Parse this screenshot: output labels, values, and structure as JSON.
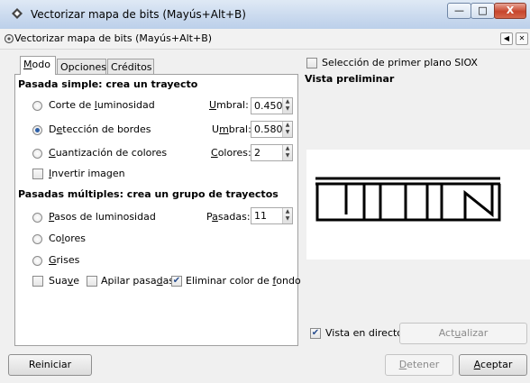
{
  "window": {
    "title": "Vectorizar mapa de bits (Mayús+Alt+B)",
    "minimize_glyph": "—",
    "maximize_glyph": "□",
    "close_glyph": "X"
  },
  "dock": {
    "title": "Vectorizar mapa de bits (Mayús+Alt+B)"
  },
  "tabs": [
    {
      "label": "Modo",
      "accel": "M",
      "rest": "odo",
      "active": true
    },
    {
      "label": "Opciones",
      "active": false
    },
    {
      "label": "Créditos",
      "active": false
    }
  ],
  "single_scan": {
    "heading": "Pasada simple: crea un trayecto",
    "brightness": {
      "pre": "Corte de ",
      "accel": "l",
      "post": "uminosidad",
      "selected": false,
      "param_accel": "U",
      "param_rest": "mbral:",
      "value": "0.450"
    },
    "edges": {
      "pre": "D",
      "accel": "e",
      "post": "tección de bordes",
      "selected": true,
      "param_pre": "U",
      "param_accel": "m",
      "param_post": "bral:",
      "value": "0.580"
    },
    "colors": {
      "pre": "",
      "accel": "C",
      "post": "uantización de colores",
      "selected": false,
      "param_accel": "C",
      "param_rest": "olores:",
      "value": "2"
    },
    "invert": {
      "accel": "I",
      "post": "nvertir imagen",
      "checked": false
    }
  },
  "multi_scan": {
    "heading": "Pasadas múltiples: crea un grupo de trayectos",
    "brightness_steps": {
      "accel": "P",
      "post": "asos de luminosidad",
      "selected": false,
      "param_pre": "P",
      "param_accel": "a",
      "param_post": "sadas:",
      "value": "11"
    },
    "colors": {
      "pre": "Co",
      "accel": "l",
      "post": "ores",
      "selected": false
    },
    "grays": {
      "accel": "G",
      "post": "rises",
      "selected": false
    },
    "smooth": {
      "pre": "Sua",
      "accel": "v",
      "post": "e",
      "checked": false
    },
    "stack": {
      "pre": "Apilar pasa",
      "accel": "d",
      "post": "as",
      "checked": false
    },
    "remove_bg": {
      "pre": "Eliminar color de ",
      "accel": "f",
      "post": "ondo",
      "checked": true
    }
  },
  "siox": {
    "label": "Selección de primer plano SIOX",
    "checked": false
  },
  "preview": {
    "heading": "Vista preliminar"
  },
  "live": {
    "label": "Vista en directo",
    "checked": true
  },
  "buttons": {
    "update": {
      "pre": "Act",
      "accel": "u",
      "post": "alizar"
    },
    "reset": "Reiniciar",
    "stop": {
      "accel": "D",
      "post": "etener"
    },
    "ok": {
      "accel": "A",
      "post": "ceptar"
    }
  },
  "icons": [
    "app-icon",
    "dock-icon",
    "restore-icon",
    "dock-close-icon",
    "spin-arrows-icon"
  ]
}
